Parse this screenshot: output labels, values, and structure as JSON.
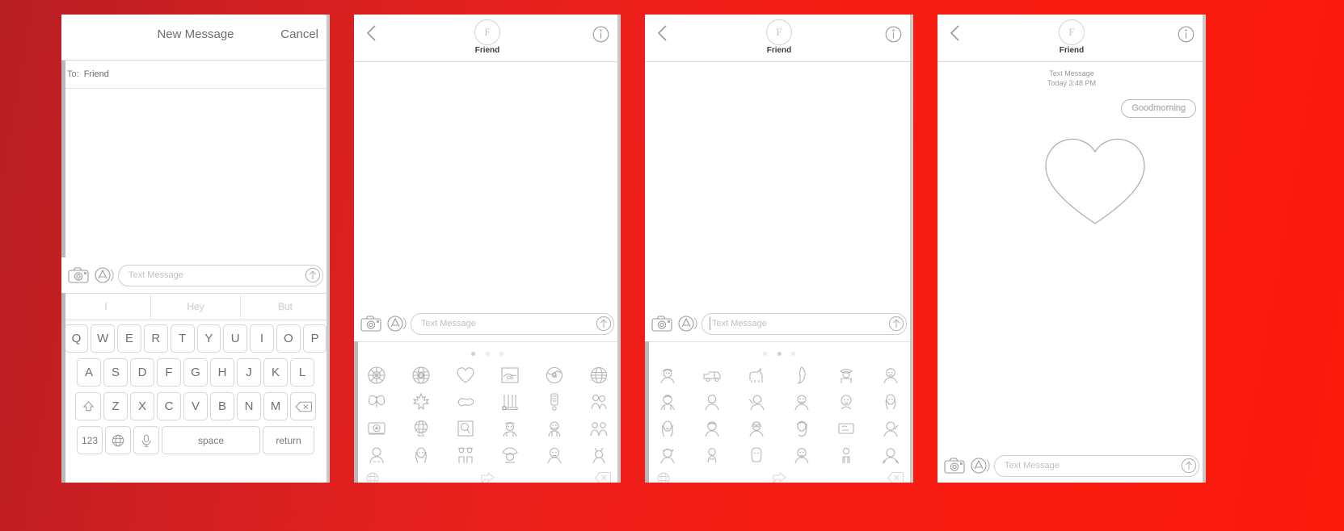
{
  "background": {
    "color_left": "#b81f24",
    "color_right": "#fb1a0c"
  },
  "panels": [
    {
      "id": "compose",
      "navbar": {
        "title": "New Message",
        "cancel_label": "Cancel"
      },
      "recipient": {
        "label": "To:",
        "value": "Friend"
      },
      "input_bar": {
        "camera_icon": "camera-icon",
        "appstore_icon": "app-store-icon",
        "placeholder": "Text Message",
        "send_icon": "send-arrow-icon"
      },
      "predictive": [
        "I",
        "Hey",
        "But"
      ],
      "keyboard": {
        "row1": [
          "Q",
          "W",
          "E",
          "R",
          "T",
          "Y",
          "U",
          "I",
          "O",
          "P"
        ],
        "row2": [
          "A",
          "S",
          "D",
          "F",
          "G",
          "H",
          "J",
          "K",
          "L"
        ],
        "row3": [
          "Z",
          "X",
          "C",
          "V",
          "B",
          "N",
          "M"
        ],
        "shift_icon": "shift-up-arrow-icon",
        "backspace_icon": "backspace-icon",
        "numbers_label": "123",
        "globe_icon": "globe-icon",
        "mic_icon": "microphone-icon",
        "space_label": "space",
        "return_label": "return"
      }
    },
    {
      "id": "conversation-stickers",
      "navbar": {
        "back_icon": "back-chevron-icon",
        "avatar_initial": "F",
        "contact_name": "Friend",
        "info_icon": "info-circle-icon"
      },
      "input_bar": {
        "camera_icon": "camera-icon",
        "appstore_icon": "app-store-icon",
        "placeholder": "Text Message",
        "send_icon": "send-arrow-icon"
      },
      "emoji_keyboard": {
        "page_dots": 3,
        "active_dot": 1,
        "stickers": [
          "cbc-gem-logo",
          "cbc-globe-logo",
          "heart-outline",
          "cbc-map-badge",
          "cbc-face-badge",
          "globe-grid",
          "butterfly",
          "maple-leaf",
          "canada-map",
          "flag-bars",
          "microphone-sticker",
          "two-people",
          "radio-camera",
          "kids-cbc-logo",
          "q-logo",
          "worker-person",
          "moustache-person",
          "group-people",
          "person-face",
          "woman-face",
          "couple-people",
          "cowboy-hat-person",
          "man-face",
          "person-waving"
        ],
        "bottom_bar": {
          "globe_icon": "globe-icon",
          "share_icon": "share-arrow-icon",
          "delete_icon": "delete-x-icon"
        }
      }
    },
    {
      "id": "conversation-emoji",
      "navbar": {
        "back_icon": "back-chevron-icon",
        "avatar_initial": "F",
        "contact_name": "Friend",
        "info_icon": "info-circle-icon"
      },
      "input_bar": {
        "camera_icon": "camera-icon",
        "appstore_icon": "app-store-icon",
        "placeholder": "Text Message",
        "send_icon": "send-arrow-icon",
        "caret_visible": true
      },
      "emoji_keyboard": {
        "page_dots": 3,
        "active_dot": 2,
        "stickers": [
          "person-hat",
          "pickup-truck",
          "donkey",
          "ghost-figure",
          "cowboy-person",
          "person-face",
          "person-face-2",
          "bearded-man",
          "person-reaching",
          "person-smiling",
          "baby-face",
          "woman-face-2",
          "woman-long-hair",
          "man-short-hair",
          "person-glasses",
          "woman-blonde",
          "tv-screen",
          "person-waving-2",
          "person-cap",
          "baby-sitting",
          "person-hoodie",
          "person-serious",
          "child-standing",
          "person-bowing"
        ],
        "bottom_bar": {
          "globe_icon": "globe-icon",
          "share_icon": "share-arrow-icon",
          "delete_icon": "delete-x-icon"
        }
      }
    },
    {
      "id": "conversation-sent",
      "navbar": {
        "back_icon": "back-chevron-icon",
        "avatar_initial": "F",
        "contact_name": "Friend",
        "info_icon": "info-circle-icon"
      },
      "timestamp": {
        "kind": "Text Message",
        "when": "Today 3:48 PM"
      },
      "message": {
        "text": "Goodmorning",
        "direction": "outgoing"
      },
      "sticker": {
        "name": "heart-outline-large"
      },
      "input_bar": {
        "camera_icon": "camera-icon",
        "appstore_icon": "app-store-icon",
        "placeholder": "Text Message",
        "send_icon": "send-arrow-icon"
      }
    }
  ]
}
